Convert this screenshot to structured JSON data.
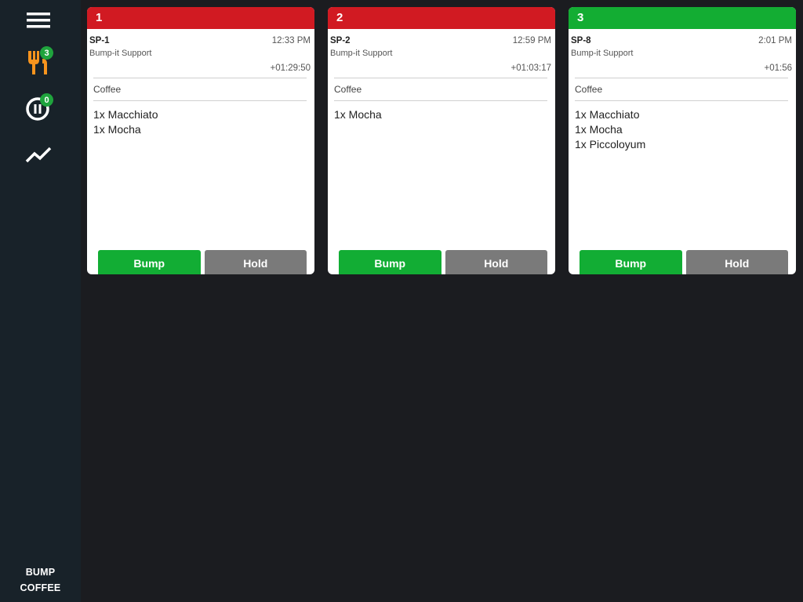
{
  "sidebar": {
    "menu_icon": "hamburger-icon",
    "orders_icon": "fork-knife-icon",
    "orders_badge": "3",
    "held_icon": "pause-circle-icon",
    "held_badge": "0",
    "stats_icon": "trend-line-icon",
    "brand_line1": "BUMP",
    "brand_line2": "COFFEE",
    "colors": {
      "orders_icon": "#f7941d",
      "badge": "#1fa43d"
    }
  },
  "cards": [
    {
      "number": "1",
      "header_color": "#d11a22",
      "order_id": "SP-1",
      "time": "12:33 PM",
      "server": "Bump-it Support",
      "elapsed": "+01:29:50",
      "category": "Coffee",
      "items": [
        "1x Macchiato",
        "1x Mocha"
      ],
      "bump_label": "Bump",
      "hold_label": "Hold"
    },
    {
      "number": "2",
      "header_color": "#d11a22",
      "order_id": "SP-2",
      "time": "12:59 PM",
      "server": "Bump-it Support",
      "elapsed": "+01:03:17",
      "category": "Coffee",
      "items": [
        "1x Mocha"
      ],
      "bump_label": "Bump",
      "hold_label": "Hold"
    },
    {
      "number": "3",
      "header_color": "#13ad33",
      "order_id": "SP-8",
      "time": "2:01 PM",
      "server": "Bump-it Support",
      "elapsed": "+01:56",
      "category": "Coffee",
      "items": [
        "1x Macchiato",
        "1x Mocha",
        "1x Piccoloyum"
      ],
      "bump_label": "Bump",
      "hold_label": "Hold"
    }
  ]
}
